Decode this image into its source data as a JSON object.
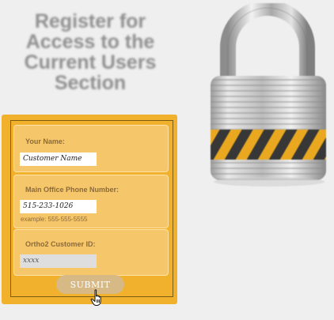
{
  "heading": {
    "line1": "Register for",
    "line2": "Access to the",
    "line3": "Current Users",
    "line4": "Section"
  },
  "form": {
    "name": {
      "label": "Your Name:",
      "value": "Customer Name"
    },
    "phone": {
      "label": "Main Office Phone Number:",
      "value": "515-233-1026",
      "hint": "example: 555-555-5555"
    },
    "customer_id": {
      "label": "Ortho2 Customer ID:",
      "value": "xxxx"
    },
    "submit_label": "SUBMIT"
  },
  "colors": {
    "background": "#efefef",
    "panel": "#f1b12c",
    "field_box": "#f6c66a",
    "heading_text": "#8f8f8f",
    "submit_button": "#d7b985"
  },
  "icons": {
    "lock": "padlock-icon",
    "cursor": "hand-pointer-icon"
  }
}
